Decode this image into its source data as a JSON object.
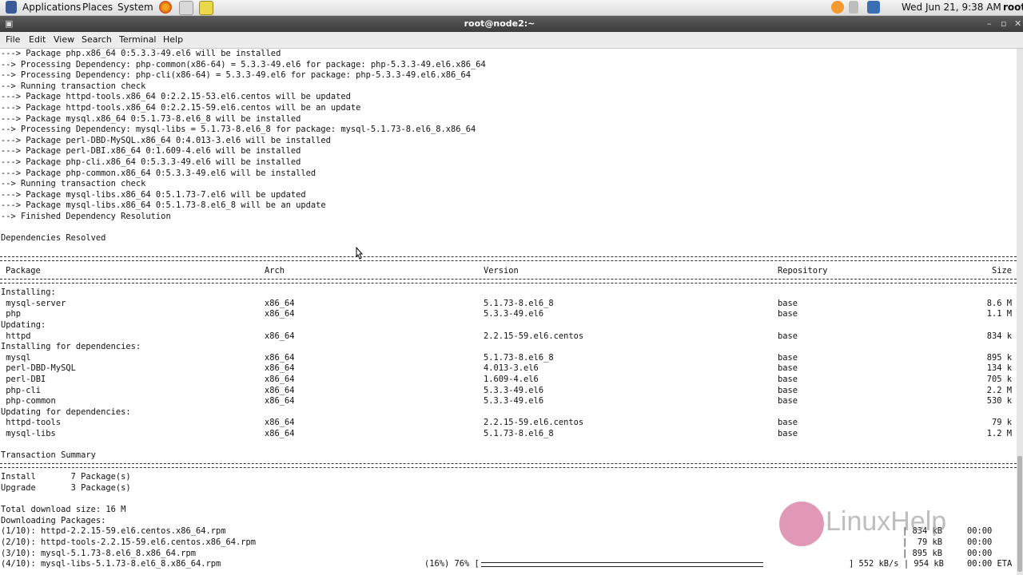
{
  "topbar": {
    "applications": "Applications",
    "places": "Places",
    "system": "System",
    "datetime": "Wed Jun 21,  9:38 AM",
    "user": "root"
  },
  "window": {
    "title": "root@node2:~",
    "buttons": {
      "minimize": "–",
      "maximize": "▫",
      "close": "✕"
    }
  },
  "menu": [
    "File",
    "Edit",
    "View",
    "Search",
    "Terminal",
    "Help"
  ],
  "terminal": {
    "log_lines": [
      "---> Package php.x86_64 0:5.3.3-49.el6 will be installed",
      "--> Processing Dependency: php-common(x86-64) = 5.3.3-49.el6 for package: php-5.3.3-49.el6.x86_64",
      "--> Processing Dependency: php-cli(x86-64) = 5.3.3-49.el6 for package: php-5.3.3-49.el6.x86_64",
      "--> Running transaction check",
      "---> Package httpd-tools.x86_64 0:2.2.15-53.el6.centos will be updated",
      "---> Package httpd-tools.x86_64 0:2.2.15-59.el6.centos will be an update",
      "---> Package mysql.x86_64 0:5.1.73-8.el6_8 will be installed",
      "--> Processing Dependency: mysql-libs = 5.1.73-8.el6_8 for package: mysql-5.1.73-8.el6_8.x86_64",
      "---> Package perl-DBD-MySQL.x86_64 0:4.013-3.el6 will be installed",
      "---> Package perl-DBI.x86_64 0:1.609-4.el6 will be installed",
      "---> Package php-cli.x86_64 0:5.3.3-49.el6 will be installed",
      "---> Package php-common.x86_64 0:5.3.3-49.el6 will be installed",
      "--> Running transaction check",
      "---> Package mysql-libs.x86_64 0:5.1.73-7.el6 will be updated",
      "---> Package mysql-libs.x86_64 0:5.1.73-8.el6_8 will be an update",
      "--> Finished Dependency Resolution"
    ],
    "deps_resolved": "Dependencies Resolved",
    "headers": [
      "Package",
      "Arch",
      "Version",
      "Repository",
      "Size"
    ],
    "table_rows": [
      {
        "section": "Installing:"
      },
      {
        "pkg": " mysql-server",
        "arch": "x86_64",
        "ver": "5.1.73-8.el6_8",
        "repo": "base",
        "size": "8.6 M"
      },
      {
        "pkg": " php",
        "arch": "x86_64",
        "ver": "5.3.3-49.el6",
        "repo": "base",
        "size": "1.1 M"
      },
      {
        "section": "Updating:"
      },
      {
        "pkg": " httpd",
        "arch": "x86_64",
        "ver": "2.2.15-59.el6.centos",
        "repo": "base",
        "size": "834 k"
      },
      {
        "section": "Installing for dependencies:"
      },
      {
        "pkg": " mysql",
        "arch": "x86_64",
        "ver": "5.1.73-8.el6_8",
        "repo": "base",
        "size": "895 k"
      },
      {
        "pkg": " perl-DBD-MySQL",
        "arch": "x86_64",
        "ver": "4.013-3.el6",
        "repo": "base",
        "size": "134 k"
      },
      {
        "pkg": " perl-DBI",
        "arch": "x86_64",
        "ver": "1.609-4.el6",
        "repo": "base",
        "size": "705 k"
      },
      {
        "pkg": " php-cli",
        "arch": "x86_64",
        "ver": "5.3.3-49.el6",
        "repo": "base",
        "size": "2.2 M"
      },
      {
        "pkg": " php-common",
        "arch": "x86_64",
        "ver": "5.3.3-49.el6",
        "repo": "base",
        "size": "530 k"
      },
      {
        "section": "Updating for dependencies:"
      },
      {
        "pkg": " httpd-tools",
        "arch": "x86_64",
        "ver": "2.2.15-59.el6.centos",
        "repo": "base",
        "size": "79 k"
      },
      {
        "pkg": " mysql-libs",
        "arch": "x86_64",
        "ver": "5.1.73-8.el6_8",
        "repo": "base",
        "size": "1.2 M"
      }
    ],
    "summary_title": "Transaction Summary",
    "summary_install": "Install       7 Package(s)",
    "summary_upgrade": "Upgrade       3 Package(s)",
    "total_size": "Total download size: 16 M",
    "downloading": "Downloading Packages:",
    "downloads": [
      {
        "name": "(1/10): httpd-2.2.15-59.el6.centos.x86_64.rpm",
        "size": "834 kB",
        "time": "00:00"
      },
      {
        "name": "(2/10): httpd-tools-2.2.15-59.el6.centos.x86_64.rpm",
        "size": " 79 kB",
        "time": "00:00"
      },
      {
        "name": "(3/10): mysql-5.1.73-8.el6_8.x86_64.rpm",
        "size": "895 kB",
        "time": "00:00"
      }
    ],
    "progress": {
      "name": "(4/10): mysql-libs-5.1.73-8.el6_8.x86_64.rpm",
      "percent_text": "(16%) 76% [",
      "bar_fill": 0.76,
      "rate": "] 552 kB/s | 954 kB",
      "eta": "00:00 ETA"
    }
  },
  "watermark": "LinuxHelp"
}
